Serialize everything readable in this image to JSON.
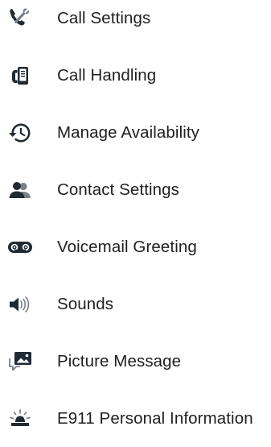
{
  "menu": {
    "items": [
      {
        "label": "Call Settings",
        "icon": "phone-wrench-icon"
      },
      {
        "label": "Call Handling",
        "icon": "phone-device-icon"
      },
      {
        "label": "Manage Availability",
        "icon": "history-clock-icon"
      },
      {
        "label": "Contact Settings",
        "icon": "contacts-people-icon"
      },
      {
        "label": "Voicemail Greeting",
        "icon": "voicemail-icon"
      },
      {
        "label": "Sounds",
        "icon": "speaker-icon"
      },
      {
        "label": "Picture Message",
        "icon": "picture-message-icon"
      },
      {
        "label": "E911 Personal Information",
        "icon": "emergency-beacon-icon"
      }
    ]
  },
  "colors": {
    "icon": "#1f2a33",
    "text": "#1f1f1f",
    "background": "#ffffff"
  }
}
